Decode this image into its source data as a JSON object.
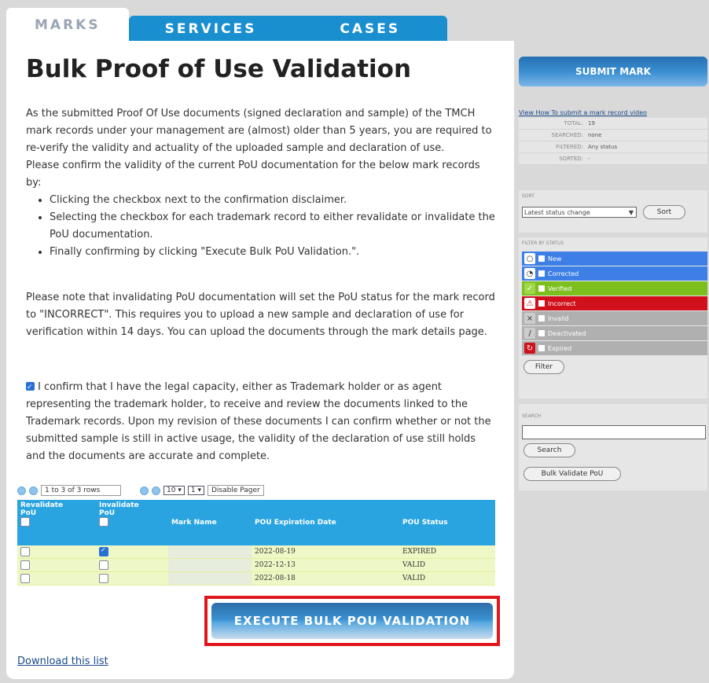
{
  "tabs": [
    "MARKS",
    "SERVICES",
    "CASES"
  ],
  "page_title": "Bulk Proof of Use Validation",
  "intro": {
    "p1": "As the submitted Proof Of Use documents (signed declaration and sample) of the TMCH mark records under your management are (almost) older than 5 years, you are required to re-verify the validity and actuality of the uploaded sample and declaration of use.",
    "p2": "Please confirm the validity of the current PoU documentation for the below mark records by:",
    "bullets": [
      "Clicking the checkbox next to the confirmation disclaimer.",
      "Selecting the checkbox for each trademark record to either revalidate or invalidate the PoU documentation.",
      "Finally confirming by clicking \"Execute Bulk PoU Validation.\"."
    ]
  },
  "note": "Please note that invalidating PoU documentation will set the PoU status for the mark record to \"INCORRECT\". This requires you to upload a new sample and declaration of use for verification within 14 days. You can upload the documents through the mark details page.",
  "confirm_text": "I confirm that I have the legal capacity, either as Trademark holder or as agent representing the trademark holder, to receive and review the documents linked to the Trademark records. Upon my revision of these documents I can confirm whether or not the submitted sample is still in active usage, the validity of the declaration of use still holds and the documents are accurate and complete.",
  "pager": {
    "range": "1 to 3 of 3 rows",
    "page_size": "10",
    "page": "1",
    "disable_label": "Disable Pager"
  },
  "table": {
    "headers": [
      "Revalidate PoU",
      "Invalidate PoU",
      "Mark Name",
      "POU Expiration Date",
      "POU Status"
    ],
    "rows": [
      {
        "revalidate": false,
        "invalidate": true,
        "mark_name": "",
        "expiration": "2022-08-19",
        "status": "EXPIRED"
      },
      {
        "revalidate": false,
        "invalidate": false,
        "mark_name": "",
        "expiration": "2022-12-13",
        "status": "VALID"
      },
      {
        "revalidate": false,
        "invalidate": false,
        "mark_name": "",
        "expiration": "2022-08-18",
        "status": "VALID"
      }
    ]
  },
  "execute_label": "EXECUTE BULK POU VALIDATION",
  "download_label": "Download this list",
  "sidebar": {
    "submit_label": "SUBMIT MARK",
    "video_link": "View How To submit a mark record video",
    "info": [
      {
        "label": "TOTAL:",
        "value": "19"
      },
      {
        "label": "SEARCHED:",
        "value": "none"
      },
      {
        "label": "FILTERED:",
        "value": "Any status"
      },
      {
        "label": "SORTED:",
        "value": "-"
      }
    ],
    "sort": {
      "label": "SORT",
      "selected": "Latest status change",
      "button": "Sort"
    },
    "filter": {
      "label": "FILTER BY STATUS",
      "statuses": [
        {
          "name": "New",
          "color": "#3d7fe6"
        },
        {
          "name": "Corrected",
          "color": "#3d7fe6"
        },
        {
          "name": "Verified",
          "color": "#7dc01e"
        },
        {
          "name": "Incorrect",
          "color": "#d0111b"
        },
        {
          "name": "Invalid",
          "color": "#b0b0b0"
        },
        {
          "name": "Deactivated",
          "color": "#b0b0b0"
        },
        {
          "name": "Expired",
          "color": "#b0b0b0"
        }
      ],
      "button": "Filter"
    },
    "search": {
      "label": "SEARCH",
      "button": "Search",
      "bulk_button": "Bulk Validate PoU"
    }
  }
}
